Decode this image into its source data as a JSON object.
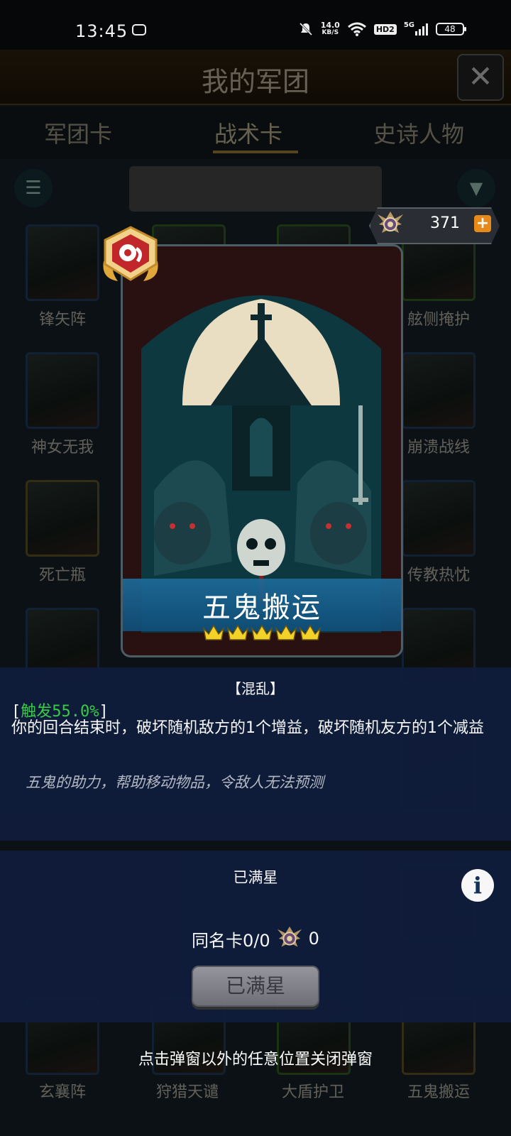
{
  "status_bar": {
    "time": "13:45",
    "net_speed_value": "14.0",
    "net_speed_unit": "KB/S",
    "hd": "HD2",
    "signal": "5G",
    "battery": "48"
  },
  "background": {
    "title": "我的军团",
    "tabs": [
      "军团卡",
      "战术卡",
      "史诗人物"
    ],
    "cards": [
      "锋矢阵",
      "舷侧掩护",
      "神女无我",
      "崩溃战线",
      "死亡瓶",
      "传教热忱",
      "玄襄阵",
      "狩猎天谴",
      "大盾护卫",
      "五鬼搬运"
    ]
  },
  "currency": {
    "value": "371",
    "plus": "+"
  },
  "card": {
    "name": "五鬼搬运",
    "stars": 5,
    "colors": {
      "crown": "#f2d229",
      "name_bar": "#1d6a99"
    }
  },
  "description": {
    "title": "【混乱】",
    "trigger_prefix": "[",
    "trigger_label": "触发55.0%",
    "trigger_suffix": "]",
    "body": "你的回合结束时，破坏随机敌方的1个增益，破坏随机友方的1个减益",
    "flavor": "五鬼的助力，帮助移动物品，令敌人无法预测"
  },
  "upgrade": {
    "status": "已满星",
    "duplicate_label": "同名卡0/0",
    "medal_count": "0",
    "button_label": "已满星",
    "info_symbol": "i"
  },
  "hint": "点击弹窗以外的任意位置关闭弹窗"
}
